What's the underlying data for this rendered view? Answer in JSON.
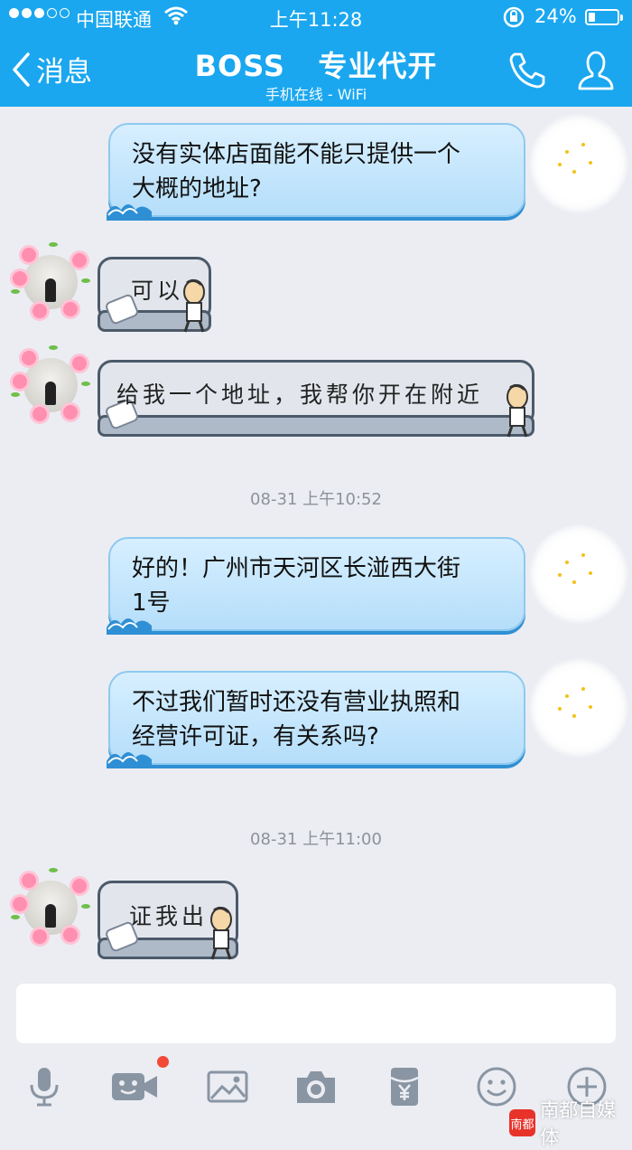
{
  "status_bar": {
    "carrier": "中国联通",
    "time": "上午11:28",
    "battery_percent": "24%",
    "battery_level": 0.24,
    "signal_bars": 3
  },
  "header": {
    "back_label": "消息",
    "title": "BOSS   专业代开",
    "subtitle": "手机在线 - WiFi"
  },
  "messages": [
    {
      "from": "me",
      "text_line1": "没有实体店面能不能只提供一个",
      "text_line2": "大概的地址?"
    },
    {
      "from": "boss",
      "text": "可以"
    },
    {
      "from": "boss",
      "text": "给我一个地址，我帮你开在附近"
    },
    {
      "timestamp": "08-31 上午10:52"
    },
    {
      "from": "me",
      "text_line1": "好的！广州市天河区长湴西大街",
      "text_line2": "1号"
    },
    {
      "from": "me",
      "text_line1": "不过我们暂时还没有营业执照和",
      "text_line2": "经营许可证，有关系吗?"
    },
    {
      "timestamp": "08-31 上午11:00"
    },
    {
      "from": "boss",
      "text": "证我出"
    }
  ],
  "input": {
    "value": ""
  },
  "toolbar": [
    "microphone-icon",
    "video-icon",
    "image-icon",
    "camera-icon",
    "red-packet-icon",
    "emoji-icon",
    "plus-icon"
  ],
  "watermark": {
    "logo_text": "南都",
    "text": "南都自媒体"
  },
  "colors": {
    "header": "#1aa7ef",
    "chat_bg": "#ebedf3",
    "my_bubble": "#c6e6fb",
    "unread_dot": "#f24a36"
  }
}
